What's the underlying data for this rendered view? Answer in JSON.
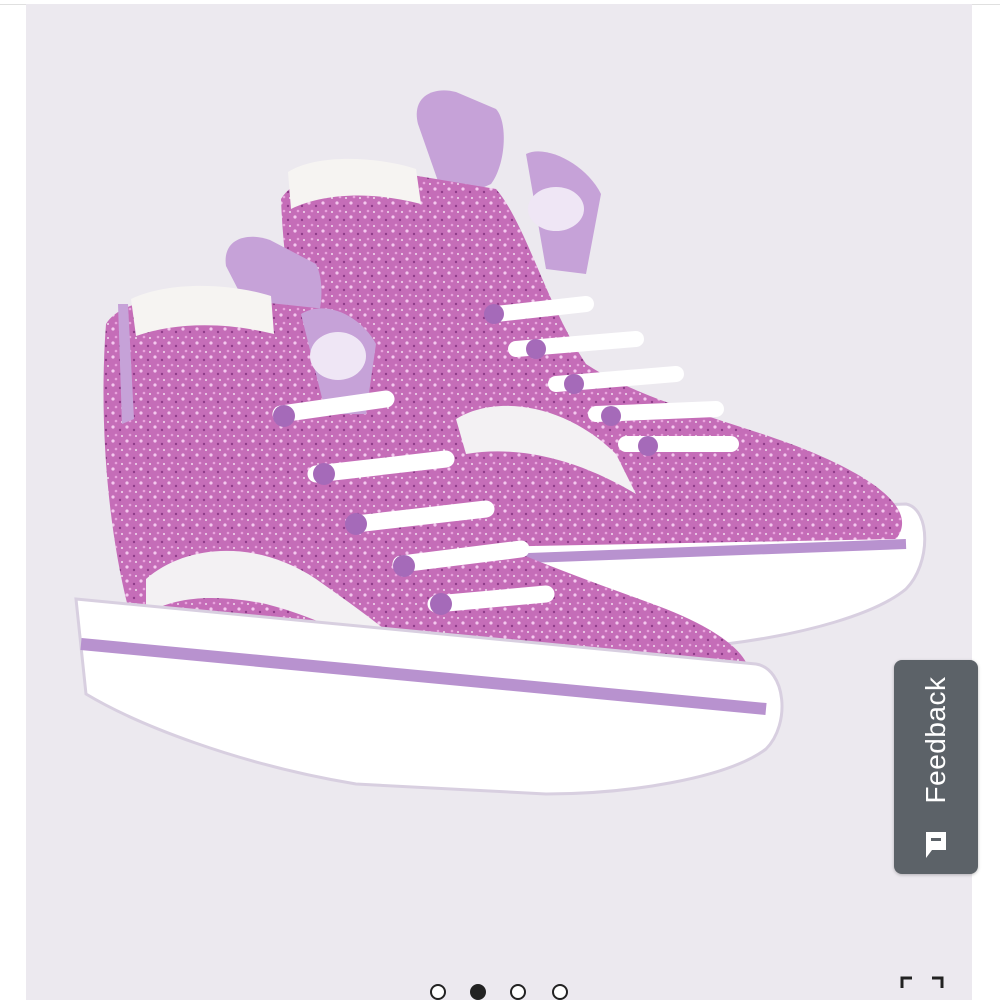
{
  "feedback": {
    "label": "Feedback",
    "icon": "feedback-card-icon",
    "background": "#5c6268"
  },
  "gallery": {
    "background": "#ece9ef",
    "slides": 4,
    "active_slide": 2,
    "expand_icon": "fullscreen-expand-icon"
  },
  "product_image": {
    "shoe_color": "#c873be",
    "accent_color": "#b892cf",
    "sole_color": "#ffffff"
  }
}
